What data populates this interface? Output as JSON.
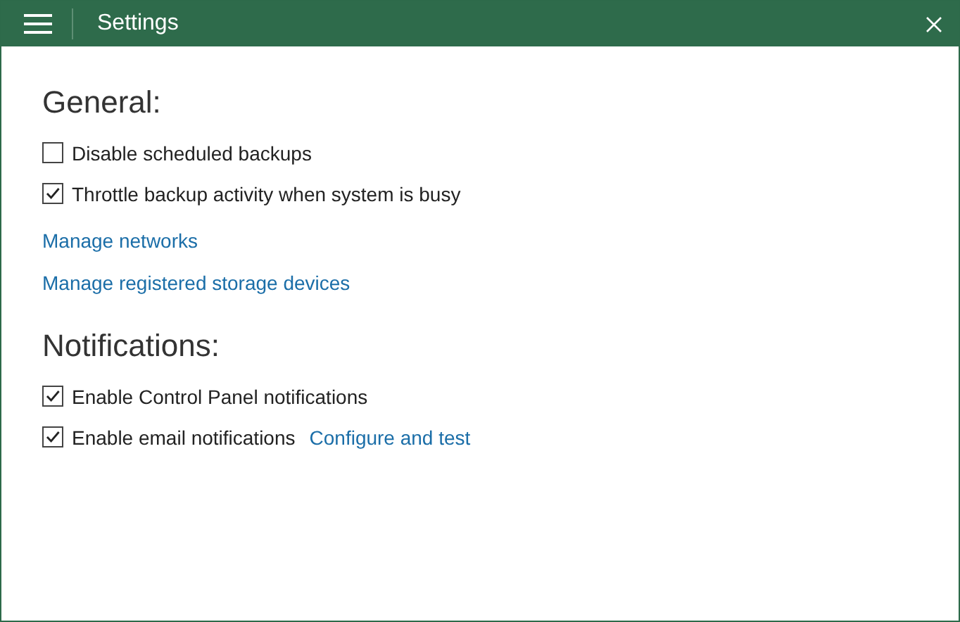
{
  "window": {
    "title": "Settings"
  },
  "sections": [
    {
      "heading": "General:",
      "items": [
        {
          "kind": "checkbox",
          "label": "Disable scheduled backups",
          "checked": false
        },
        {
          "kind": "checkbox",
          "label": "Throttle backup activity when system is busy",
          "checked": true
        },
        {
          "kind": "link",
          "label": "Manage networks"
        },
        {
          "kind": "link",
          "label": "Manage registered storage devices"
        }
      ]
    },
    {
      "heading": "Notifications:",
      "items": [
        {
          "kind": "checkbox",
          "label": "Enable Control Panel notifications",
          "checked": true
        },
        {
          "kind": "checkbox",
          "label": "Enable email notifications",
          "checked": true,
          "link": "Configure and test"
        }
      ]
    }
  ]
}
